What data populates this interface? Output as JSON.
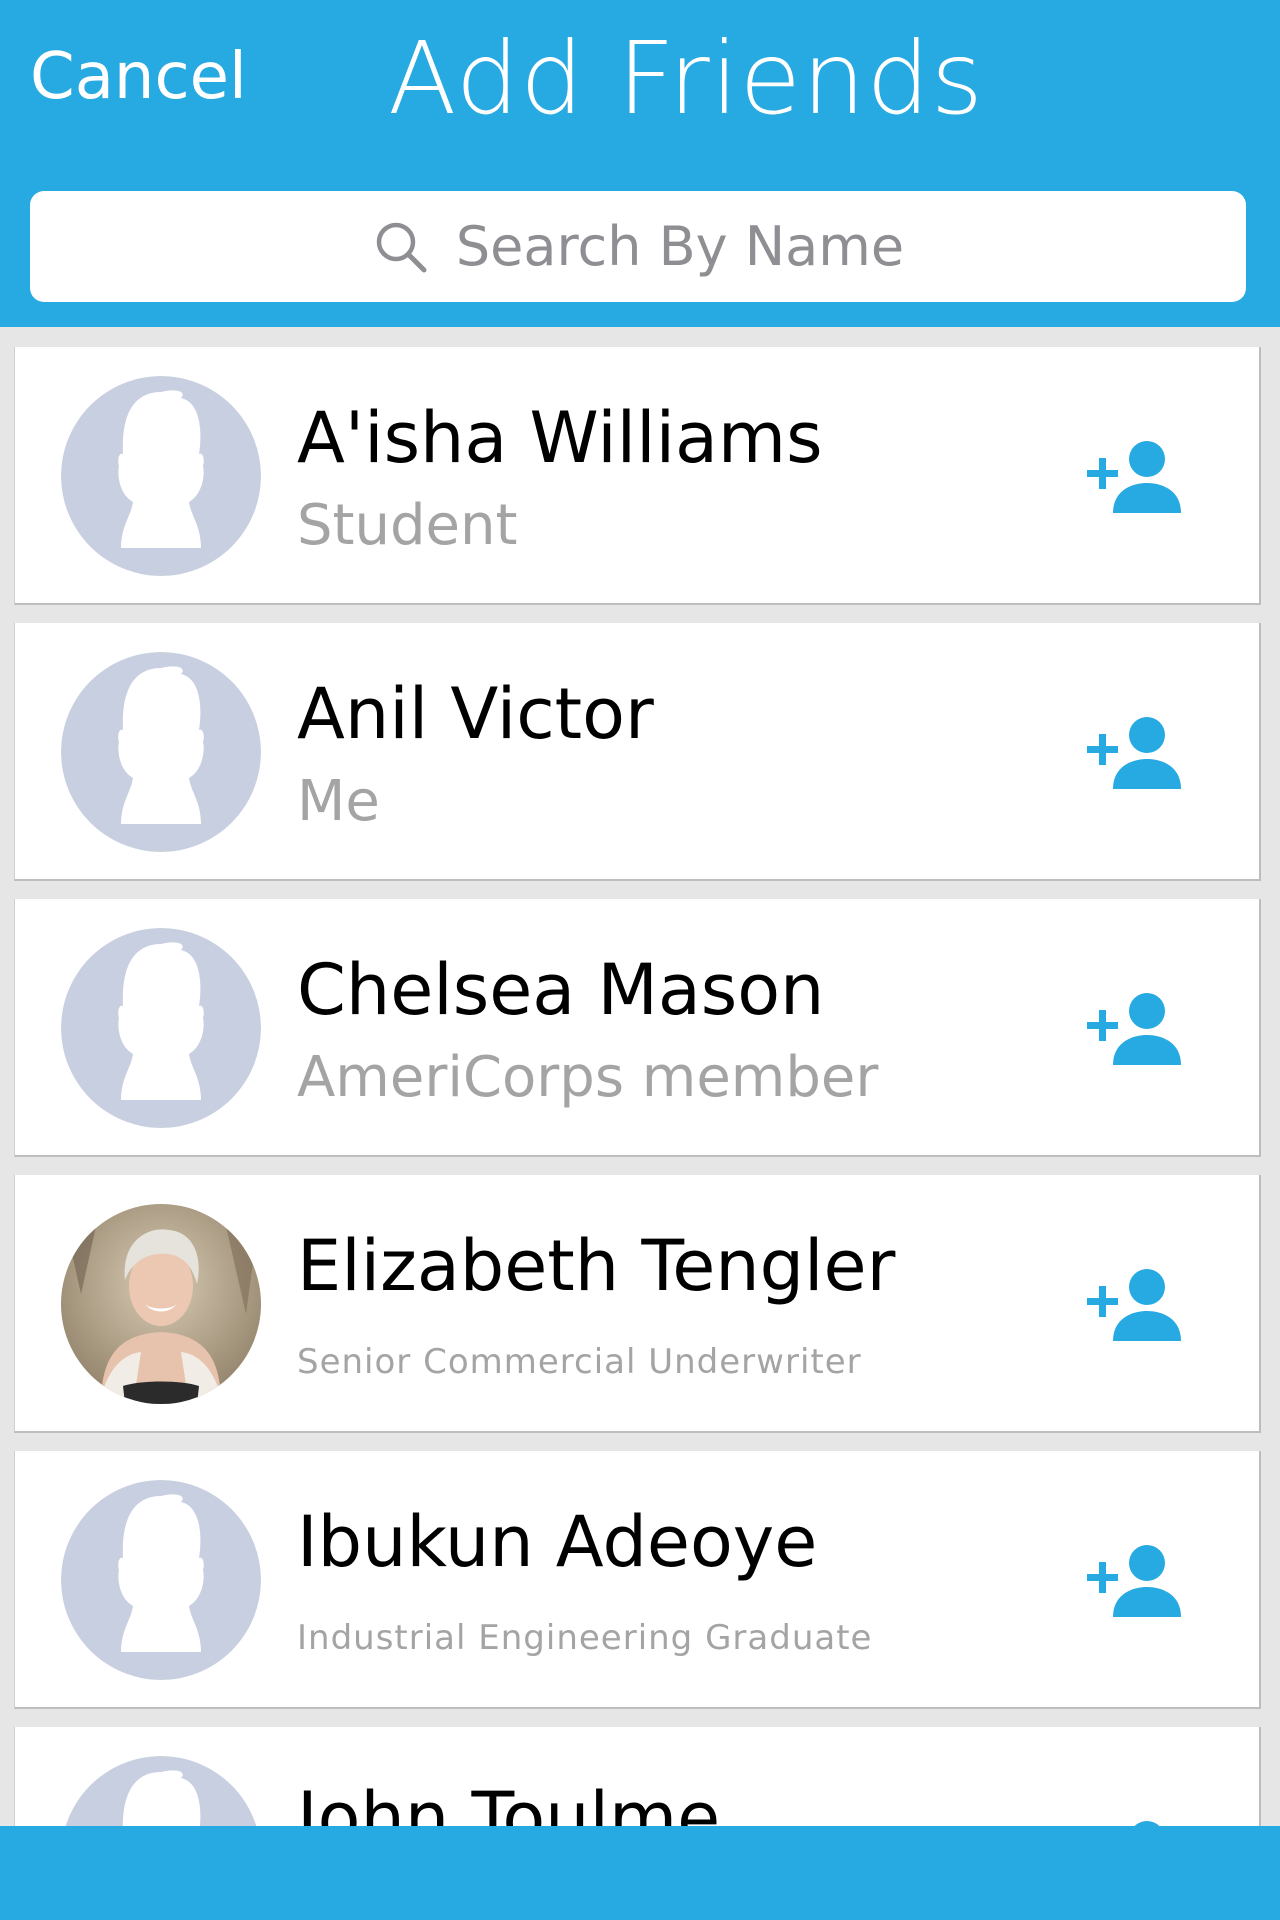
{
  "header": {
    "cancel_label": "Cancel",
    "title": "Add Friends",
    "search_placeholder": "Search By Name",
    "search_icon": "search-icon"
  },
  "contacts": [
    {
      "name": "A'isha Williams",
      "subtitle": "Student",
      "avatar": "default-avatar-icon",
      "action_icon": "add-friend-icon"
    },
    {
      "name": "Anil Victor",
      "subtitle": "Me",
      "avatar": "default-avatar-icon",
      "action_icon": "add-friend-icon"
    },
    {
      "name": "Chelsea Mason",
      "subtitle": "AmeriCorps member",
      "avatar": "default-avatar-icon",
      "action_icon": "add-friend-icon"
    },
    {
      "name": "Elizabeth Tengler",
      "subtitle": "Senior Commercial Underwriter",
      "avatar": "profile-photo",
      "action_icon": "add-friend-icon"
    },
    {
      "name": "Ibukun Adeoye",
      "subtitle": "Industrial Engineering Graduate",
      "avatar": "default-avatar-icon",
      "action_icon": "add-friend-icon"
    },
    {
      "name": "John Toulme",
      "subtitle": "",
      "avatar": "default-avatar-icon",
      "action_icon": "add-friend-icon"
    }
  ],
  "colors": {
    "accent": "#27a9e1",
    "background": "#e6e6e6",
    "avatar_placeholder": "#c8cfe0",
    "subtitle_text": "#a4a4a4"
  }
}
